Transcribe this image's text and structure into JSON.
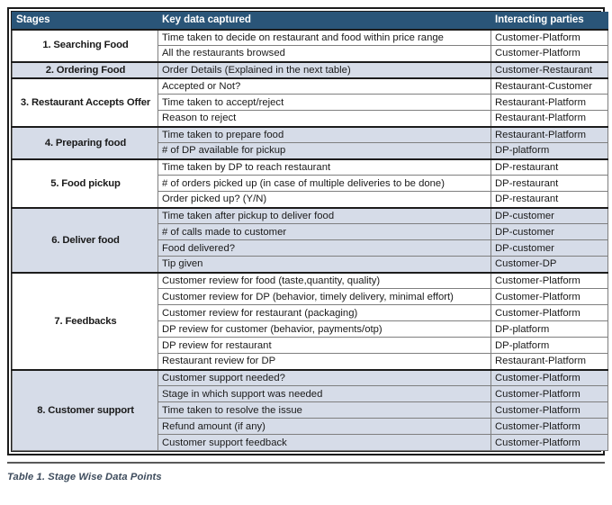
{
  "table": {
    "columns": [
      "Stages",
      "Key data captured",
      "Interacting parties"
    ],
    "groups": [
      {
        "stage": "1. Searching Food",
        "shaded": false,
        "rows": [
          {
            "key": "Time taken to decide on restaurant and food within price range",
            "party": "Customer-Platform"
          },
          {
            "key": "All the restaurants browsed",
            "party": "Customer-Platform"
          }
        ]
      },
      {
        "stage": "2. Ordering Food",
        "shaded": true,
        "rows": [
          {
            "key": "Order Details (Explained in the next table)",
            "party": "Customer-Restaurant"
          }
        ]
      },
      {
        "stage": "3. Restaurant Accepts Offer",
        "shaded": false,
        "rows": [
          {
            "key": "Accepted or Not?",
            "party": "Restaurant-Customer"
          },
          {
            "key": "Time taken to accept/reject",
            "party": "Restaurant-Platform"
          },
          {
            "key": "Reason to reject",
            "party": "Restaurant-Platform"
          }
        ]
      },
      {
        "stage": "4. Preparing food",
        "shaded": true,
        "rows": [
          {
            "key": "Time taken to prepare food",
            "party": "Restaurant-Platform"
          },
          {
            "key": "# of DP available for pickup",
            "party": "DP-platform"
          }
        ]
      },
      {
        "stage": "5. Food pickup",
        "shaded": false,
        "rows": [
          {
            "key": "Time taken by DP to reach restaurant",
            "party": "DP-restaurant"
          },
          {
            "key": "# of orders picked up (in case of multiple deliveries to be done)",
            "party": "DP-restaurant"
          },
          {
            "key": "Order picked up? (Y/N)",
            "party": "DP-restaurant"
          }
        ]
      },
      {
        "stage": "6. Deliver food",
        "shaded": true,
        "rows": [
          {
            "key": "Time taken after pickup to deliver food",
            "party": "DP-customer"
          },
          {
            "key": "# of calls made to customer",
            "party": "DP-customer"
          },
          {
            "key": "Food delivered?",
            "party": "DP-customer"
          },
          {
            "key": "Tip given",
            "party": "Customer-DP"
          }
        ]
      },
      {
        "stage": "7. Feedbacks",
        "shaded": false,
        "rows": [
          {
            "key": "Customer review for food (taste,quantity, quality)",
            "party": "Customer-Platform"
          },
          {
            "key": "Customer review for DP (behavior, timely delivery, minimal effort)",
            "party": "Customer-Platform"
          },
          {
            "key": "Customer review for restaurant (packaging)",
            "party": "Customer-Platform"
          },
          {
            "key": "DP review for customer (behavior, payments/otp)",
            "party": "DP-platform"
          },
          {
            "key": "DP review for restaurant",
            "party": "DP-platform"
          },
          {
            "key": "Restaurant review for DP",
            "party": "Restaurant-Platform"
          }
        ]
      },
      {
        "stage": "8. Customer support",
        "shaded": true,
        "rows": [
          {
            "key": "Customer support needed?",
            "party": "Customer-Platform"
          },
          {
            "key": "Stage in which support was needed",
            "party": "Customer-Platform"
          },
          {
            "key": "Time taken to resolve the issue",
            "party": "Customer-Platform"
          },
          {
            "key": "Refund amount (if any)",
            "party": "Customer-Platform"
          },
          {
            "key": "Customer support feedback",
            "party": "Customer-Platform"
          }
        ]
      }
    ]
  },
  "caption": "Table 1. Stage Wise Data Points",
  "colors": {
    "header_background": "#2a5578",
    "header_text": "#ffffff",
    "band_background": "#d6dce8",
    "plain_background": "#ffffff",
    "grid_line": "#7f7f7f",
    "outer_border": "#1c1c1c",
    "caption_text": "#3d4b5c"
  }
}
